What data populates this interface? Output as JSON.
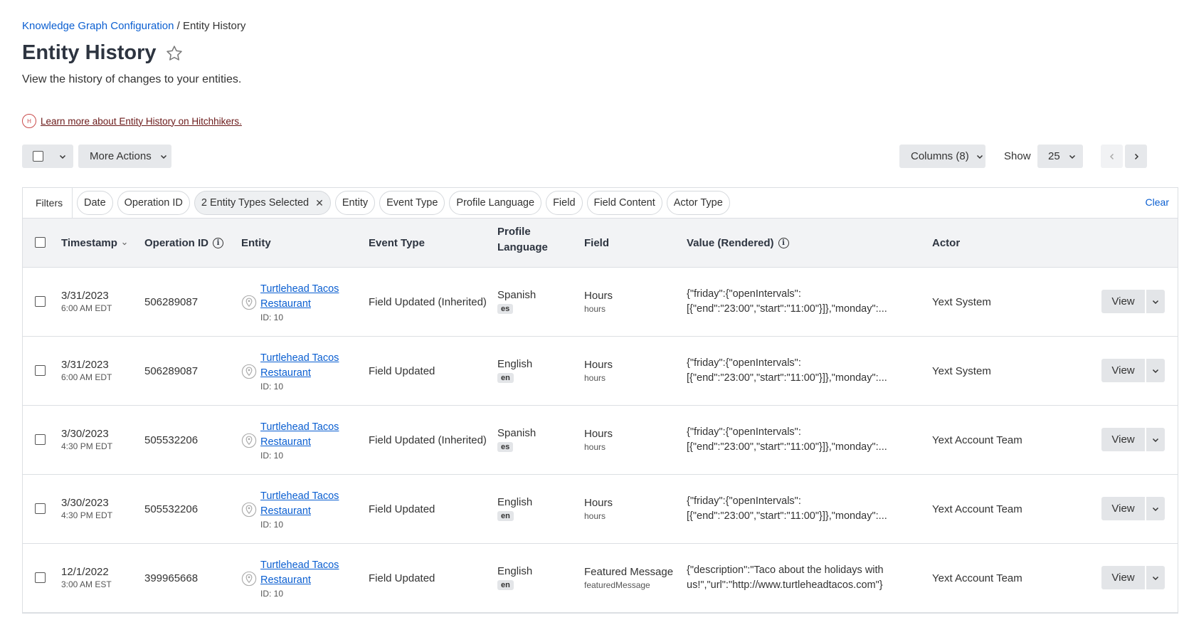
{
  "breadcrumb": {
    "parent": "Knowledge Graph Configuration",
    "separator": "/",
    "current": "Entity History"
  },
  "page": {
    "title": "Entity History",
    "subtitle": "View the history of changes to your entities.",
    "learn_more": "Learn more about Entity History on Hitchhikers."
  },
  "toolbar": {
    "more_actions": "More Actions",
    "columns": "Columns (8)",
    "show_label": "Show",
    "show_value": "25"
  },
  "filters": {
    "label": "Filters",
    "chips": [
      "Date",
      "Operation ID",
      "2 Entity Types Selected",
      "Entity",
      "Event Type",
      "Profile Language",
      "Field",
      "Field Content",
      "Actor Type"
    ],
    "clear": "Clear"
  },
  "table": {
    "headers": {
      "timestamp": "Timestamp",
      "operation_id": "Operation ID",
      "entity": "Entity",
      "event_type": "Event Type",
      "profile_language_1": "Profile",
      "profile_language_2": "Language",
      "field": "Field",
      "value": "Value (Rendered)",
      "actor": "Actor"
    },
    "view_label": "View",
    "rows": [
      {
        "date": "3/31/2023",
        "time": "6:00 AM EDT",
        "op": "506289087",
        "entity1": "Turtlehead Tacos",
        "entity2": "Restaurant",
        "entity_id": "ID: 10",
        "event": "Field Updated (Inherited)",
        "lang": "Spanish",
        "lang_code": "es",
        "field": "Hours",
        "field_key": "hours",
        "value1": "{\"friday\":{\"openIntervals\":",
        "value2": "[{\"end\":\"23:00\",\"start\":\"11:00\"}]},\"monday\":...",
        "actor": "Yext System"
      },
      {
        "date": "3/31/2023",
        "time": "6:00 AM EDT",
        "op": "506289087",
        "entity1": "Turtlehead Tacos",
        "entity2": "Restaurant",
        "entity_id": "ID: 10",
        "event": "Field Updated",
        "lang": "English",
        "lang_code": "en",
        "field": "Hours",
        "field_key": "hours",
        "value1": "{\"friday\":{\"openIntervals\":",
        "value2": "[{\"end\":\"23:00\",\"start\":\"11:00\"}]},\"monday\":...",
        "actor": "Yext System"
      },
      {
        "date": "3/30/2023",
        "time": "4:30 PM EDT",
        "op": "505532206",
        "entity1": "Turtlehead Tacos",
        "entity2": "Restaurant",
        "entity_id": "ID: 10",
        "event": "Field Updated (Inherited)",
        "lang": "Spanish",
        "lang_code": "es",
        "field": "Hours",
        "field_key": "hours",
        "value1": "{\"friday\":{\"openIntervals\":",
        "value2": "[{\"end\":\"23:00\",\"start\":\"11:00\"}]},\"monday\":...",
        "actor": "Yext Account Team"
      },
      {
        "date": "3/30/2023",
        "time": "4:30 PM EDT",
        "op": "505532206",
        "entity1": "Turtlehead Tacos",
        "entity2": "Restaurant",
        "entity_id": "ID: 10",
        "event": "Field Updated",
        "lang": "English",
        "lang_code": "en",
        "field": "Hours",
        "field_key": "hours",
        "value1": "{\"friday\":{\"openIntervals\":",
        "value2": "[{\"end\":\"23:00\",\"start\":\"11:00\"}]},\"monday\":...",
        "actor": "Yext Account Team"
      },
      {
        "date": "12/1/2022",
        "time": "3:00 AM EST",
        "op": "399965668",
        "entity1": "Turtlehead Tacos",
        "entity2": "Restaurant",
        "entity_id": "ID: 10",
        "event": "Field Updated",
        "lang": "English",
        "lang_code": "en",
        "field": "Featured Message",
        "field_key": "featuredMessage",
        "value1": "{\"description\":\"Taco about the holidays with",
        "value2": "us!\",\"url\":\"http://www.turtleheadtacos.com\"}",
        "actor": "Yext Account Team"
      }
    ]
  }
}
